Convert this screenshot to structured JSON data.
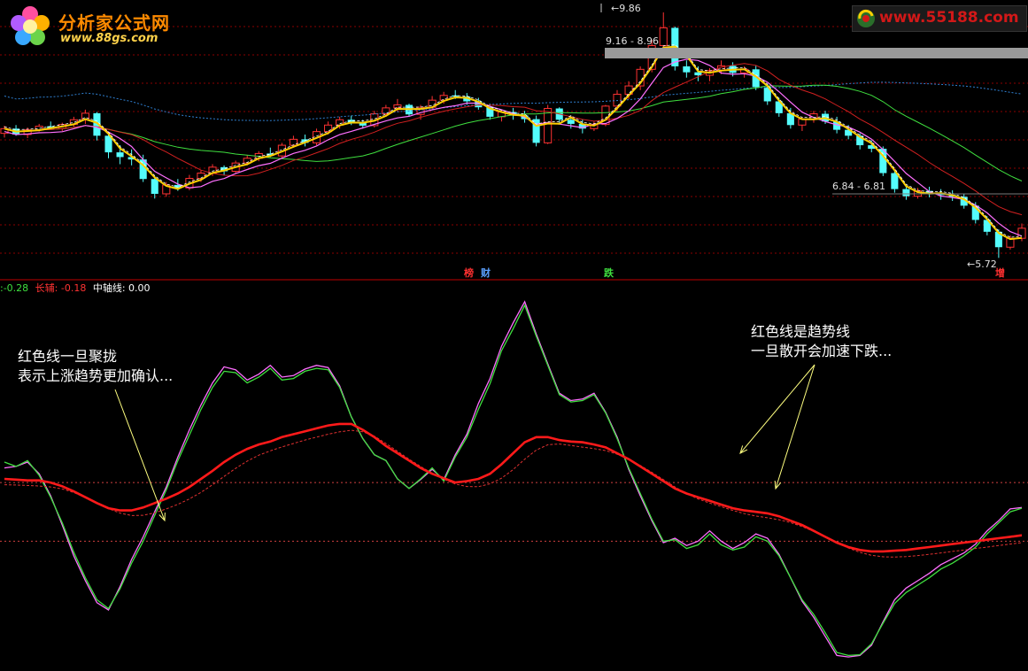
{
  "logo_left": {
    "title": "分析家公式网",
    "url": "www.88gs.com"
  },
  "logo_right": {
    "url": "www.55188.com"
  },
  "legend": {
    "items": [
      {
        "text": ":-0.28",
        "color": "#3fdf3f"
      },
      {
        "text": "长辅: -0.18",
        "color": "#ff3333"
      },
      {
        "text": "中轴线: 0.00",
        "color": "#ffffff"
      }
    ]
  },
  "signals": [
    {
      "text": "榜",
      "color": "#ff3030"
    },
    {
      "text": "财",
      "color": "#5aa0ff"
    },
    {
      "text": "跌",
      "color": "#3fdf3f"
    },
    {
      "text": "增",
      "color": "#ff3030"
    }
  ],
  "annotations": [
    {
      "lines": [
        "红色线一旦聚拢",
        "表示上涨趋势更加确认..."
      ]
    },
    {
      "lines": [
        "红色线是趋势线",
        "一旦散开会加速下跌..."
      ]
    }
  ],
  "price_labels": {
    "high": "9.86",
    "band1": "9.16 - 8.96",
    "band2": "6.84 - 6.81",
    "low": "5.72"
  },
  "colors": {
    "up": "#ff3232",
    "down": "#54fcfc",
    "grid": "#8b0000",
    "fast": "#ff6fff",
    "mid": "#3fdf3f",
    "trend": "#ff1a1a",
    "yellow": "#ffd000"
  },
  "chart_data": [
    {
      "type": "candlestick",
      "candles": [
        [
          7.82,
          7.95,
          7.75,
          7.9
        ],
        [
          7.9,
          7.96,
          7.78,
          7.8
        ],
        [
          7.8,
          7.92,
          7.74,
          7.88
        ],
        [
          7.88,
          7.98,
          7.85,
          7.94
        ],
        [
          7.94,
          8.02,
          7.88,
          7.9
        ],
        [
          7.9,
          8.0,
          7.86,
          7.97
        ],
        [
          7.97,
          8.1,
          7.93,
          8.05
        ],
        [
          8.05,
          8.22,
          7.98,
          8.16
        ],
        [
          8.16,
          8.18,
          7.7,
          7.78
        ],
        [
          7.78,
          7.85,
          7.4,
          7.5
        ],
        [
          7.5,
          7.62,
          7.3,
          7.42
        ],
        [
          7.42,
          7.55,
          7.28,
          7.38
        ],
        [
          7.38,
          7.46,
          7.0,
          7.05
        ],
        [
          7.05,
          7.1,
          6.72,
          6.8
        ],
        [
          6.8,
          7.0,
          6.75,
          6.95
        ],
        [
          6.95,
          7.05,
          6.85,
          6.9
        ],
        [
          6.9,
          7.12,
          6.86,
          7.06
        ],
        [
          7.06,
          7.2,
          7.0,
          7.15
        ],
        [
          7.15,
          7.3,
          7.1,
          7.25
        ],
        [
          7.25,
          7.28,
          7.12,
          7.18
        ],
        [
          7.18,
          7.36,
          7.15,
          7.32
        ],
        [
          7.32,
          7.45,
          7.28,
          7.4
        ],
        [
          7.4,
          7.52,
          7.35,
          7.48
        ],
        [
          7.48,
          7.58,
          7.42,
          7.44
        ],
        [
          7.44,
          7.66,
          7.4,
          7.62
        ],
        [
          7.62,
          7.78,
          7.58,
          7.72
        ],
        [
          7.72,
          7.8,
          7.6,
          7.66
        ],
        [
          7.66,
          7.9,
          7.62,
          7.85
        ],
        [
          7.85,
          8.02,
          7.8,
          7.96
        ],
        [
          7.96,
          8.1,
          7.9,
          8.05
        ],
        [
          8.05,
          8.12,
          7.96,
          8.0
        ],
        [
          8.0,
          8.05,
          7.9,
          7.95
        ],
        [
          7.95,
          8.2,
          7.92,
          8.15
        ],
        [
          8.15,
          8.3,
          8.1,
          8.25
        ],
        [
          8.25,
          8.4,
          8.18,
          8.3
        ],
        [
          8.3,
          8.32,
          8.1,
          8.14
        ],
        [
          8.14,
          8.3,
          8.05,
          8.26
        ],
        [
          8.26,
          8.45,
          8.22,
          8.38
        ],
        [
          8.38,
          8.52,
          8.32,
          8.46
        ],
        [
          8.46,
          8.55,
          8.4,
          8.44
        ],
        [
          8.44,
          8.5,
          8.3,
          8.36
        ],
        [
          8.36,
          8.42,
          8.22,
          8.26
        ],
        [
          8.26,
          8.32,
          8.05,
          8.1
        ],
        [
          8.1,
          8.22,
          8.02,
          8.18
        ],
        [
          8.18,
          8.25,
          8.05,
          8.12
        ],
        [
          8.12,
          8.2,
          8.0,
          8.06
        ],
        [
          8.06,
          8.12,
          7.6,
          7.66
        ],
        [
          7.66,
          8.3,
          7.64,
          8.24
        ],
        [
          8.24,
          8.26,
          8.0,
          8.05
        ],
        [
          8.05,
          8.12,
          7.9,
          7.98
        ],
        [
          7.98,
          8.06,
          7.82,
          7.9
        ],
        [
          7.9,
          8.02,
          7.86,
          7.97
        ],
        [
          7.97,
          8.3,
          7.94,
          8.28
        ],
        [
          8.28,
          8.55,
          8.2,
          8.48
        ],
        [
          8.48,
          8.7,
          8.4,
          8.62
        ],
        [
          8.62,
          8.95,
          8.55,
          8.9
        ],
        [
          8.9,
          9.4,
          8.85,
          9.3
        ],
        [
          9.3,
          9.86,
          9.2,
          9.6
        ],
        [
          9.6,
          9.62,
          8.88,
          8.95
        ],
        [
          8.95,
          9.05,
          8.76,
          8.85
        ],
        [
          8.85,
          8.95,
          8.7,
          8.8
        ],
        [
          8.8,
          8.92,
          8.7,
          8.88
        ],
        [
          8.88,
          9.05,
          8.82,
          8.96
        ],
        [
          8.96,
          9.02,
          8.78,
          8.84
        ],
        [
          8.84,
          8.95,
          8.76,
          8.9
        ],
        [
          8.9,
          8.96,
          8.55,
          8.6
        ],
        [
          8.6,
          8.66,
          8.3,
          8.36
        ],
        [
          8.36,
          8.42,
          8.1,
          8.16
        ],
        [
          8.16,
          8.25,
          7.9,
          7.96
        ],
        [
          7.96,
          8.1,
          7.86,
          8.06
        ],
        [
          8.06,
          8.2,
          8.0,
          8.15
        ],
        [
          8.15,
          8.2,
          7.98,
          8.02
        ],
        [
          8.02,
          8.1,
          7.82,
          7.88
        ],
        [
          7.88,
          7.96,
          7.72,
          7.78
        ],
        [
          7.78,
          7.82,
          7.55,
          7.62
        ],
        [
          7.62,
          7.7,
          7.5,
          7.56
        ],
        [
          7.56,
          7.6,
          7.1,
          7.15
        ],
        [
          7.15,
          7.2,
          6.82,
          6.88
        ],
        [
          6.88,
          6.95,
          6.7,
          6.76
        ],
        [
          6.76,
          6.9,
          6.72,
          6.85
        ],
        [
          6.85,
          6.92,
          6.74,
          6.8
        ],
        [
          6.8,
          6.88,
          6.7,
          6.78
        ],
        [
          6.78,
          6.86,
          6.68,
          6.75
        ],
        [
          6.75,
          6.8,
          6.55,
          6.6
        ],
        [
          6.6,
          6.66,
          6.3,
          6.36
        ],
        [
          6.36,
          6.42,
          6.1,
          6.16
        ],
        [
          6.16,
          6.2,
          5.72,
          5.9
        ],
        [
          5.9,
          6.1,
          5.86,
          6.05
        ],
        [
          6.05,
          6.3,
          6.0,
          6.22
        ]
      ],
      "ma_period_fast": 5,
      "ma_period_slow": 10,
      "ma_period_long": 60
    },
    {
      "type": "line",
      "series": [
        {
          "values": [
            0.28,
            0.22,
            0.3,
            0.1,
            -0.2,
            -0.55,
            -0.95,
            -1.3,
            -1.6,
            -1.72,
            -1.45,
            -1.1,
            -0.8,
            -0.45,
            -0.1,
            0.3,
            0.65,
            1.0,
            1.3,
            1.52,
            1.5,
            1.36,
            1.44,
            1.56,
            1.4,
            1.42,
            1.52,
            1.56,
            1.54,
            1.3,
            0.9,
            0.6,
            0.38,
            0.3,
            0.05,
            -0.08,
            0.05,
            0.2,
            0.02,
            0.35,
            0.62,
            1.0,
            1.35,
            1.8,
            2.1,
            2.42,
            2.0,
            1.6,
            1.2,
            1.1,
            1.12,
            1.2,
            0.95,
            0.6,
            0.2,
            -0.15,
            -0.5,
            -0.8,
            -0.78,
            -0.9,
            -0.85,
            -0.7,
            -0.85,
            -0.92,
            -0.88,
            -0.74,
            -0.8,
            -1.0,
            -1.3,
            -1.6,
            -1.8,
            -2.05,
            -2.32,
            -2.36,
            -2.35,
            -2.2,
            -1.92,
            -1.65,
            -1.5,
            -1.4,
            -1.3,
            -1.18,
            -1.1,
            -1.0,
            -0.88,
            -0.7,
            -0.55,
            -0.4,
            -0.35
          ]
        },
        {
          "values": [
            0.2,
            0.22,
            0.28,
            0.12,
            -0.18,
            -0.58,
            -1.0,
            -1.34,
            -1.64,
            -1.74,
            -1.42,
            -1.05,
            -0.74,
            -0.4,
            -0.06,
            0.35,
            0.72,
            1.06,
            1.36,
            1.58,
            1.54,
            1.4,
            1.48,
            1.6,
            1.44,
            1.46,
            1.55,
            1.6,
            1.57,
            1.32,
            0.9,
            0.6,
            0.38,
            0.3,
            0.05,
            -0.08,
            0.04,
            0.18,
            0.04,
            0.38,
            0.66,
            1.08,
            1.42,
            1.86,
            2.18,
            2.47,
            2.03,
            1.62,
            1.22,
            1.12,
            1.14,
            1.22,
            0.96,
            0.62,
            0.18,
            -0.18,
            -0.52,
            -0.82,
            -0.76,
            -0.86,
            -0.8,
            -0.66,
            -0.8,
            -0.9,
            -0.82,
            -0.7,
            -0.76,
            -0.98,
            -1.3,
            -1.62,
            -1.84,
            -2.1,
            -2.36,
            -2.38,
            -2.36,
            -2.22,
            -1.9,
            -1.6,
            -1.44,
            -1.34,
            -1.24,
            -1.12,
            -1.04,
            -0.96,
            -0.84,
            -0.66,
            -0.52,
            -0.36,
            -0.34
          ]
        },
        {
          "values": [
            0.05,
            0.04,
            0.03,
            0.03,
            0.0,
            -0.05,
            -0.12,
            -0.2,
            -0.28,
            -0.35,
            -0.38,
            -0.38,
            -0.34,
            -0.28,
            -0.22,
            -0.15,
            -0.06,
            0.05,
            0.16,
            0.28,
            0.38,
            0.46,
            0.52,
            0.56,
            0.62,
            0.66,
            0.7,
            0.74,
            0.78,
            0.8,
            0.8,
            0.72,
            0.62,
            0.5,
            0.4,
            0.3,
            0.2,
            0.12,
            0.06,
            0.0,
            0.02,
            0.05,
            0.12,
            0.25,
            0.4,
            0.55,
            0.62,
            0.62,
            0.58,
            0.56,
            0.55,
            0.52,
            0.48,
            0.4,
            0.32,
            0.22,
            0.12,
            0.02,
            -0.08,
            -0.15,
            -0.2,
            -0.25,
            -0.3,
            -0.35,
            -0.38,
            -0.4,
            -0.42,
            -0.46,
            -0.52,
            -0.58,
            -0.66,
            -0.74,
            -0.82,
            -0.88,
            -0.92,
            -0.94,
            -0.94,
            -0.93,
            -0.92,
            -0.9,
            -0.88,
            -0.86,
            -0.84,
            -0.82,
            -0.8,
            -0.78,
            -0.76,
            -0.74,
            -0.72
          ]
        }
      ],
      "reference_levels": [
        0.0,
        -0.8
      ]
    }
  ]
}
